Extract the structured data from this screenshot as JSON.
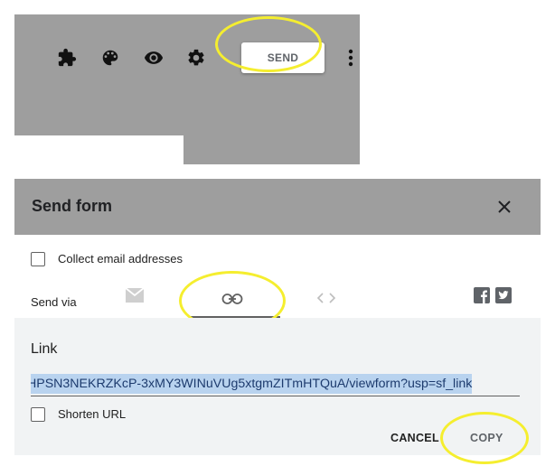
{
  "toolbar": {
    "icons": [
      "puzzle-icon",
      "palette-icon",
      "eye-icon",
      "gear-icon"
    ],
    "send_label": "SEND",
    "more_icon": "more-vert-icon"
  },
  "dialog": {
    "title": "Send form",
    "close_icon": "close-icon",
    "collect_email_label": "Collect email addresses",
    "collect_email_checked": false,
    "send_via_label": "Send via",
    "send_via_options": [
      "email-icon",
      "link-icon",
      "embed-icon"
    ],
    "active_send_via": "link-icon",
    "social_icons": [
      "facebook-icon",
      "twitter-icon"
    ],
    "link_heading": "Link",
    "link_value": "HPSN3NEKRZKcP-3xMY3WINuVUg5xtgmZITmHTQuA/viewform?usp=sf_link",
    "shorten_url_label": "Shorten URL",
    "shorten_url_checked": false,
    "cancel_label": "CANCEL",
    "copy_label": "COPY"
  },
  "colors": {
    "panel_gray": "#9e9e9e",
    "highlight_yellow": "#f5ee2f",
    "link_selection": "#b9d3ef"
  }
}
